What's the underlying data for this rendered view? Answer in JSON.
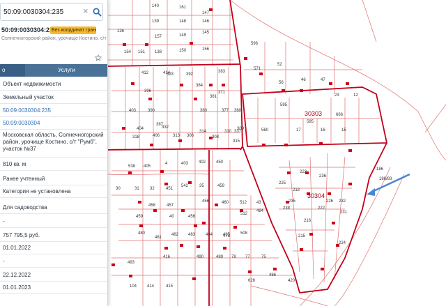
{
  "search": {
    "value": "50:09:0030304:235"
  },
  "header": {
    "parcel_id": "50:09:0030304:235",
    "coord_badge": "Без координат границ",
    "address_line": "Солнечногорский район, урочище Костино, с/т \"Румб\","
  },
  "tabs": [
    {
      "label": "о"
    },
    {
      "label": "Услуги"
    }
  ],
  "rows": [
    {
      "text": "Объект недвижимости"
    },
    {
      "text": "Земельный участок"
    },
    {
      "text": "50:09:0030304:235"
    },
    {
      "text": "50:09:0030304"
    },
    {
      "text": "Московская область, Солнечногорский район, урочище Костино, с/т \"Румб\", участок №37"
    },
    {
      "text": "810 кв. м"
    },
    {
      "text": "Ранее учтенный"
    },
    {
      "text": "Категория не установлена"
    },
    {
      "text": "Для садоводства"
    },
    {
      "text": "-"
    },
    {
      "text": "757 795,5 руб."
    },
    {
      "text": "01.01.2022"
    },
    {
      "text": "-"
    },
    {
      "text": "22.12.2022"
    },
    {
      "text": "01.01.2023"
    }
  ],
  "map": {
    "line_color": "#d0021b",
    "thin_line_color": "#e06a6a",
    "arrow_color": "#4a86d4",
    "quarter_labels": [
      "30303",
      "30304"
    ],
    "parcel_labels": [
      "140",
      "161",
      "147",
      "139",
      "148",
      "146",
      "157",
      "149",
      "145",
      "138",
      "150",
      "156",
      "136",
      "154",
      "151",
      "596",
      "595",
      "666",
      "47",
      "46",
      "52",
      "56",
      "571",
      "23",
      "12",
      "595",
      "30303",
      "560",
      "17",
      "16",
      "15",
      "412",
      "414",
      "396",
      "390",
      "387",
      "393",
      "392",
      "384",
      "380",
      "381",
      "383",
      "371",
      "377",
      "360",
      "337",
      "403",
      "404",
      "406",
      "332",
      "318",
      "313",
      "306",
      "314",
      "308",
      "310",
      "309",
      "315",
      "538",
      "405",
      "4",
      "403",
      "402",
      "450",
      "30",
      "31",
      "32",
      "451",
      "542",
      "35",
      "459",
      "458",
      "457",
      "456",
      "460",
      "512",
      "43",
      "459",
      "40",
      "456",
      "512",
      "484",
      "478",
      "508",
      "480",
      "481",
      "482",
      "483",
      "484",
      "485",
      "493",
      "416",
      "490",
      "489",
      "78",
      "77",
      "75",
      "420",
      "104",
      "414",
      "415",
      "626",
      "486",
      "218",
      "223",
      "225",
      "236",
      "30304",
      "238",
      "235",
      "222",
      "226",
      "232",
      "231",
      "224",
      "216",
      "215",
      "186",
      "186/83"
    ]
  }
}
